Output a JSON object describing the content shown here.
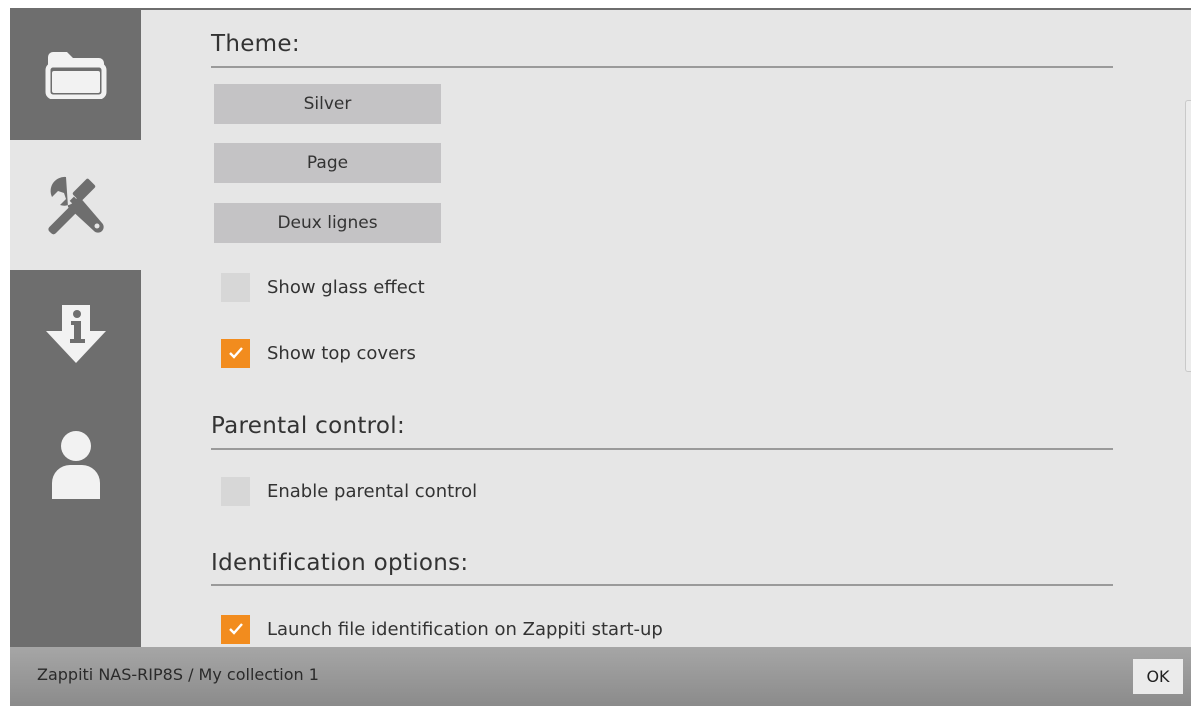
{
  "sidebar": {
    "tabs": [
      {
        "icon": "folder-icon",
        "active": false
      },
      {
        "icon": "tools-icon",
        "active": true
      },
      {
        "icon": "download-info-icon",
        "active": false
      },
      {
        "icon": "user-icon",
        "active": false
      }
    ]
  },
  "theme": {
    "title": "Theme:",
    "buttons": [
      "Silver",
      "Page",
      "Deux lignes"
    ],
    "options": [
      {
        "label": "Show glass effect",
        "checked": false
      },
      {
        "label": "Show top covers",
        "checked": true
      }
    ]
  },
  "parental": {
    "title": "Parental control:",
    "options": [
      {
        "label": "Enable parental control",
        "checked": false
      }
    ]
  },
  "identification": {
    "title": "Identification options:",
    "options": [
      {
        "label": "Launch file identification on Zappiti start-up",
        "checked": true
      }
    ]
  },
  "status": {
    "breadcrumb": "Zappiti NAS-RIP8S / My collection 1",
    "ok_label": "OK"
  },
  "colors": {
    "accent": "#f28c1e",
    "sidebar": "#6e6e6e",
    "panel": "#e6e6e6"
  }
}
